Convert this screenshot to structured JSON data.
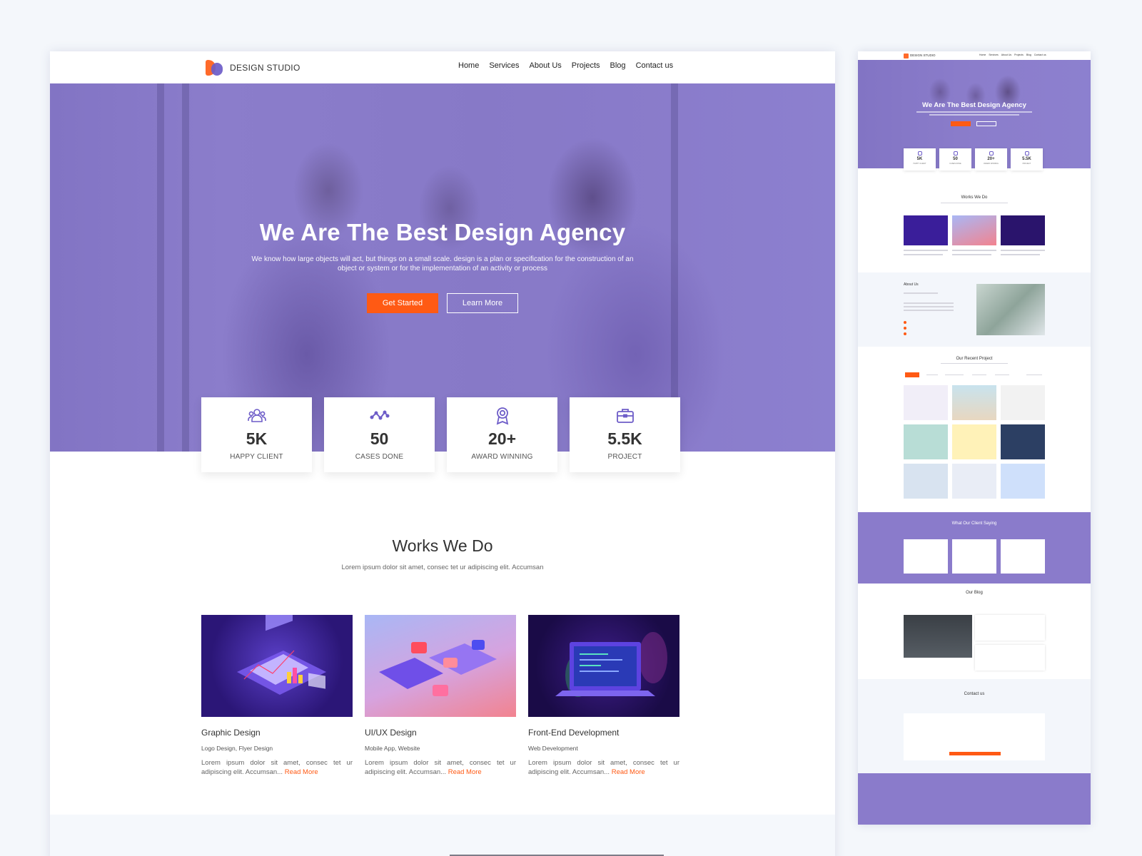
{
  "brand": {
    "name": "DESIGN STUDIO"
  },
  "nav": {
    "items": [
      "Home",
      "Services",
      "About Us",
      "Projects",
      "Blog",
      "Contact us"
    ]
  },
  "hero": {
    "title": "We Are The Best Design Agency",
    "text": "We know how large objects will act, but things on a small scale. design is a plan or specification for the construction of an object or system or for the implementation of an activity or process",
    "primary_btn": "Get Started",
    "secondary_btn": "Learn More"
  },
  "stats": [
    {
      "icon": "users-icon",
      "value": "5K",
      "label": "HAPPY CLIENT"
    },
    {
      "icon": "trend-icon",
      "value": "50",
      "label": "CASES DONE"
    },
    {
      "icon": "award-icon",
      "value": "20+",
      "label": "AWARD WINNING"
    },
    {
      "icon": "briefcase-icon",
      "value": "5.5K",
      "label": "PROJECT"
    }
  ],
  "works": {
    "title": "Works We Do",
    "subtitle": "Lorem ipsum dolor sit amet, consec tet ur adipiscing elit. Accumsan",
    "cards": [
      {
        "title": "Graphic Design",
        "tags": "Logo Design, Flyer Design",
        "desc": "Lorem ipsum dolor sit amet, consec tet ur adipiscing elit. Accumsan...",
        "link": "Read More"
      },
      {
        "title": "UI/UX Design",
        "tags": "Mobile App, Website",
        "desc": "Lorem ipsum dolor sit amet, consec tet ur adipiscing elit. Accumsan...",
        "link": "Read More"
      },
      {
        "title": "Front-End Development",
        "tags": "Web Development",
        "desc": "Lorem ipsum dolor sit amet, consec tet ur adipiscing elit. Accumsan...",
        "link": "Read More"
      }
    ]
  },
  "mini": {
    "about_title": "About Us",
    "recent_title": "Our Recent Project",
    "testimonial_title": "What Our Client Saying",
    "blog_title": "Our Blog",
    "contact_title": "Contact us"
  },
  "colors": {
    "accent": "#ff5a14",
    "brand": "#6d5cc8",
    "hero_overlay": "#8779c7"
  }
}
